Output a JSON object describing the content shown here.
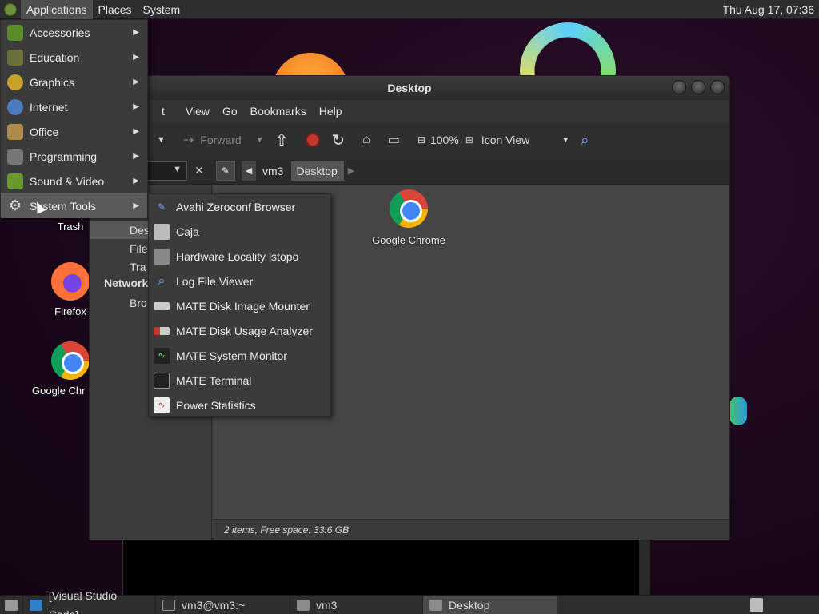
{
  "top_panel": {
    "menus": [
      "Applications",
      "Places",
      "System"
    ],
    "clock": "Thu Aug 17, 07:36"
  },
  "desktop": {
    "icons": [
      {
        "label": "Trash",
        "icon": "trash-icon"
      },
      {
        "label": "Firefox",
        "icon": "firefox-icon"
      },
      {
        "label": "Google Chr",
        "icon": "chrome-icon"
      }
    ]
  },
  "app_menu": {
    "items": [
      {
        "label": "Accessories",
        "icon": "accessories-icon"
      },
      {
        "label": "Education",
        "icon": "education-icon"
      },
      {
        "label": "Graphics",
        "icon": "graphics-icon"
      },
      {
        "label": "Internet",
        "icon": "internet-icon"
      },
      {
        "label": "Office",
        "icon": "office-icon"
      },
      {
        "label": "Programming",
        "icon": "programming-icon"
      },
      {
        "label": "Sound & Video",
        "icon": "sound-video-icon"
      },
      {
        "label": "System Tools",
        "icon": "system-tools-icon"
      }
    ]
  },
  "system_tools_menu": {
    "items": [
      {
        "label": "Avahi Zeroconf Browser",
        "icon": "avahi-icon"
      },
      {
        "label": "Caja",
        "icon": "file-manager-icon"
      },
      {
        "label": "Hardware Locality lstopo",
        "icon": "hardware-icon"
      },
      {
        "label": "Log File Viewer",
        "icon": "log-viewer-icon"
      },
      {
        "label": "MATE Disk Image Mounter",
        "icon": "disk-mounter-icon"
      },
      {
        "label": "MATE Disk Usage Analyzer",
        "icon": "disk-usage-icon"
      },
      {
        "label": "MATE System Monitor",
        "icon": "system-monitor-icon"
      },
      {
        "label": "MATE Terminal",
        "icon": "terminal-icon"
      },
      {
        "label": "Power Statistics",
        "icon": "power-stats-icon"
      }
    ]
  },
  "file_manager": {
    "title": "Desktop",
    "menubar": [
      "t",
      "View",
      "Go",
      "Bookmarks",
      "Help"
    ],
    "toolbar": {
      "forward": "Forward",
      "zoom": "100%",
      "view_mode": "Icon View"
    },
    "breadcrumbs": [
      "vm3",
      "Desktop"
    ],
    "sidebar": {
      "places": [
        "Des",
        "File",
        "Tra"
      ],
      "network_header": "Network",
      "network": [
        "Bro"
      ]
    },
    "files": [
      {
        "label": "Google Chrome",
        "icon": "chrome-icon"
      }
    ],
    "status": "2 items, Free space: 33.6 GB"
  },
  "taskbar": {
    "items": [
      {
        "label": "[Visual Studio Code]",
        "icon": "vscode-icon"
      },
      {
        "label": "vm3@vm3:~",
        "icon": "terminal-icon"
      },
      {
        "label": "vm3",
        "icon": "folder-icon"
      },
      {
        "label": "Desktop",
        "icon": "folder-icon"
      }
    ]
  }
}
